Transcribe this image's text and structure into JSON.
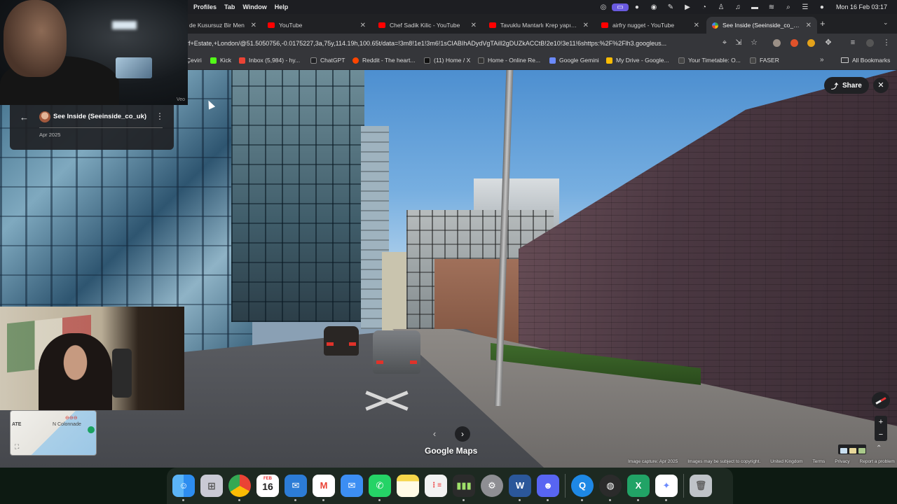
{
  "menubar": {
    "menus": [
      "Profiles",
      "Tab",
      "Window",
      "Help"
    ],
    "status_icons": [
      "creative-cloud-icon",
      "screen-share-icon",
      "dot-icon",
      "spotify-icon",
      "pen-icon",
      "play-icon",
      "clock-icon",
      "drop-icon",
      "headphones-icon",
      "battery-icon",
      "wifi-icon",
      "search-icon",
      "control-center-icon",
      "siri-icon"
    ],
    "clock": "Mon 16 Feb  03:17"
  },
  "tabs": [
    {
      "title": "de Kusursuz Bir Men",
      "favicon": "youtube",
      "active": false
    },
    {
      "title": "YouTube",
      "favicon": "youtube",
      "active": false
    },
    {
      "title": "Chef Sadik Kilic - YouTube",
      "favicon": "youtube",
      "active": false
    },
    {
      "title": "Tavuklu Mantarlı Krep yapıyor",
      "favicon": "youtube",
      "active": false
    },
    {
      "title": "airfry nugget - YouTube",
      "favicon": "youtube",
      "active": false
    },
    {
      "title": "See Inside (Seeinside_co_uk)",
      "favicon": "google-maps",
      "active": true
    }
  ],
  "toolbar": {
    "url": "rf+Estate,+London/@51.5050756,-0.0175227,3a,75y,114.19h,100.65t/data=!3m8!1e1!3m6!1sCIABIhADydVgTAiIl2gDUZkACCtB!2e10!3e11!6shttps:%2F%2Flh3.googleus..."
  },
  "bookmarks": [
    {
      "label": "Çeviri",
      "color": "#4285f4"
    },
    {
      "label": "Kick",
      "color": "#53fc18"
    },
    {
      "label": "Inbox (5,984) - hy...",
      "color": "#ea4335"
    },
    {
      "label": "ChatGPT",
      "color": "#202124"
    },
    {
      "label": "Reddit - The heart...",
      "color": "#ff4500"
    },
    {
      "label": "(11) Home / X",
      "color": "#111111"
    },
    {
      "label": "Home - Online Re...",
      "color": "#333333"
    },
    {
      "label": "Google Gemini",
      "color": "#6b8afd"
    },
    {
      "label": "My Drive - Google...",
      "color": "#fbbc04"
    },
    {
      "label": "Your Timetable: O...",
      "color": "#444444"
    },
    {
      "label": "FASER",
      "color": "#444444"
    }
  ],
  "all_bookmarks": "All Bookmarks",
  "streetview": {
    "contributor": "See Inside (Seeinside_co_uk)",
    "date": "Apr 2025",
    "share_label": "Share",
    "brand": "Google Maps",
    "minimap_label": "N Colonnade",
    "minimap_tate": "ATE",
    "webcam_tag": "Veo"
  },
  "footer": [
    "Image capture: Apr 2025",
    "Images may be subject to copyright.",
    "United Kingdom",
    "Terms",
    "Privacy",
    "Report a problem"
  ],
  "dock": {
    "calendar_month": "FEB",
    "calendar_day": "16",
    "apps": [
      {
        "name": "finder",
        "color": "#2d8df0"
      },
      {
        "name": "launchpad",
        "color": "#c9c9d4"
      },
      {
        "name": "chrome",
        "color": "#e8e8e8"
      },
      {
        "name": "calendar",
        "color": "#ffffff"
      },
      {
        "name": "outlook-mail",
        "color": "#2c7cd6"
      },
      {
        "name": "gmail",
        "color": "#ffffff"
      },
      {
        "name": "mail",
        "color": "#3c8ef3"
      },
      {
        "name": "whatsapp",
        "color": "#25d366"
      },
      {
        "name": "notes",
        "color": "#f6d64a"
      },
      {
        "name": "reminders",
        "color": "#f2f2f2"
      },
      {
        "name": "app-store-chart",
        "color": "#2b2b2b"
      },
      {
        "name": "system-settings",
        "color": "#8e8e93"
      },
      {
        "name": "word",
        "color": "#2b579a"
      },
      {
        "name": "discord",
        "color": "#5865f2"
      },
      {
        "name": "quicktime",
        "color": "#1e88e5"
      },
      {
        "name": "obs",
        "color": "#2b2b2b"
      },
      {
        "name": "excel",
        "color": "#21a366"
      },
      {
        "name": "gemini",
        "color": "#ffffff"
      },
      {
        "name": "trash",
        "color": "#bfc3c8"
      }
    ]
  }
}
